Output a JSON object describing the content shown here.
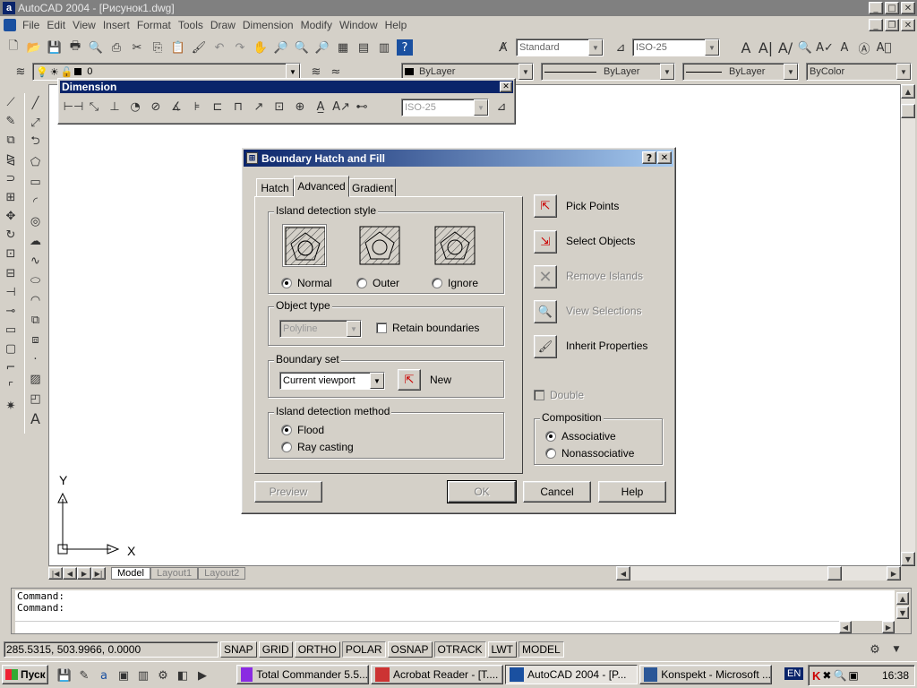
{
  "app": {
    "title": "AutoCAD 2004 - [Рисунок1.dwg]"
  },
  "menu": [
    "File",
    "Edit",
    "View",
    "Insert",
    "Format",
    "Tools",
    "Draw",
    "Dimension",
    "Modify",
    "Window",
    "Help"
  ],
  "text_style": "Standard",
  "dim_style": "ISO-25",
  "layer": "0",
  "props": {
    "color": "ByLayer",
    "linetype": "ByLayer",
    "lineweight": "ByLayer",
    "plotstyle": "ByColor"
  },
  "dim_toolbar": {
    "title": "Dimension",
    "style": "ISO-25"
  },
  "dialog": {
    "title": "Boundary Hatch and Fill",
    "tabs": [
      "Hatch",
      "Advanced",
      "Gradient"
    ],
    "island_style": {
      "label": "Island detection style",
      "options": [
        "Normal",
        "Outer",
        "Ignore"
      ],
      "selected": "Normal"
    },
    "object_type": {
      "label": "Object type",
      "value": "Polyline",
      "retain": "Retain boundaries"
    },
    "boundary_set": {
      "label": "Boundary set",
      "value": "Current viewport",
      "new": "New"
    },
    "island_method": {
      "label": "Island detection method",
      "options": [
        "Flood",
        "Ray casting"
      ],
      "selected": "Flood"
    },
    "actions": [
      "Pick Points",
      "Select Objects",
      "Remove Islands",
      "View Selections",
      "Inherit Properties"
    ],
    "double": "Double",
    "composition": {
      "label": "Composition",
      "options": [
        "Associative",
        "Nonassociative"
      ],
      "selected": "Associative"
    },
    "buttons": {
      "preview": "Preview",
      "ok": "OK",
      "cancel": "Cancel",
      "help": "Help"
    }
  },
  "ucs": {
    "x": "X",
    "y": "Y"
  },
  "layout_tabs": [
    "Model",
    "Layout1",
    "Layout2"
  ],
  "command_lines": [
    "Command:",
    "Command:"
  ],
  "status": {
    "coords": "285.5315, 503.9966, 0.0000",
    "toggles": [
      "SNAP",
      "GRID",
      "ORTHO",
      "POLAR",
      "OSNAP",
      "OTRACK",
      "LWT",
      "MODEL"
    ]
  },
  "taskbar": {
    "start": "Пуск",
    "tasks": [
      "Total Commander 5.5...",
      "Acrobat Reader - [T....",
      "AutoCAD 2004 - [P...",
      "Konspekt - Microsoft ..."
    ],
    "lang": "EN",
    "time": "16:38"
  }
}
